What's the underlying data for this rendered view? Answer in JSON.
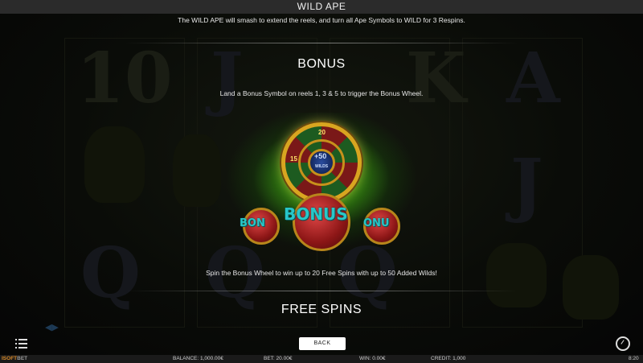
{
  "game_title": "WILD APE",
  "top_text": "The WILD APE will smash to extend the reels, and turn all Ape Symbols to WILD for 3 Respins.",
  "bonus_section": {
    "title": "BONUS",
    "intro": "Land a Bonus Symbol on reels 1, 3 & 5 to trigger the Bonus Wheel.",
    "outro": "Spin the Bonus Wheel to win up to 20 Free Spins with up to 50 Added Wilds!",
    "wheel": {
      "top_value": "20",
      "mid_value": "+50",
      "left_value": "15",
      "hub_label": "WILDS"
    },
    "symbol_text": "BONUS",
    "side_symbol_left": "BON",
    "side_symbol_right": "ONU"
  },
  "free_spins_section": {
    "title": "FREE SPINS"
  },
  "back_button": "BACK",
  "bottom_bar": {
    "brand_main": "ISOFT",
    "brand_sub": "BET",
    "balance_label": "BALANCE:",
    "balance_value": "1,000.00€",
    "bet_label": "BET:",
    "bet_value": "20.00€",
    "win_label": "WIN:",
    "win_value": "0.00€",
    "credit_label": "CREDIT:",
    "credit_value": "1,000",
    "clock": "8:20"
  },
  "background_symbols": [
    "10",
    "J",
    "Q",
    "K",
    "A",
    "Q",
    "J",
    "Q"
  ],
  "colors": {
    "glow": "#78ff28",
    "wheel_gold": "#d9a520",
    "bonus_logo": "#27c7c9",
    "brand": "#d88a2a"
  }
}
